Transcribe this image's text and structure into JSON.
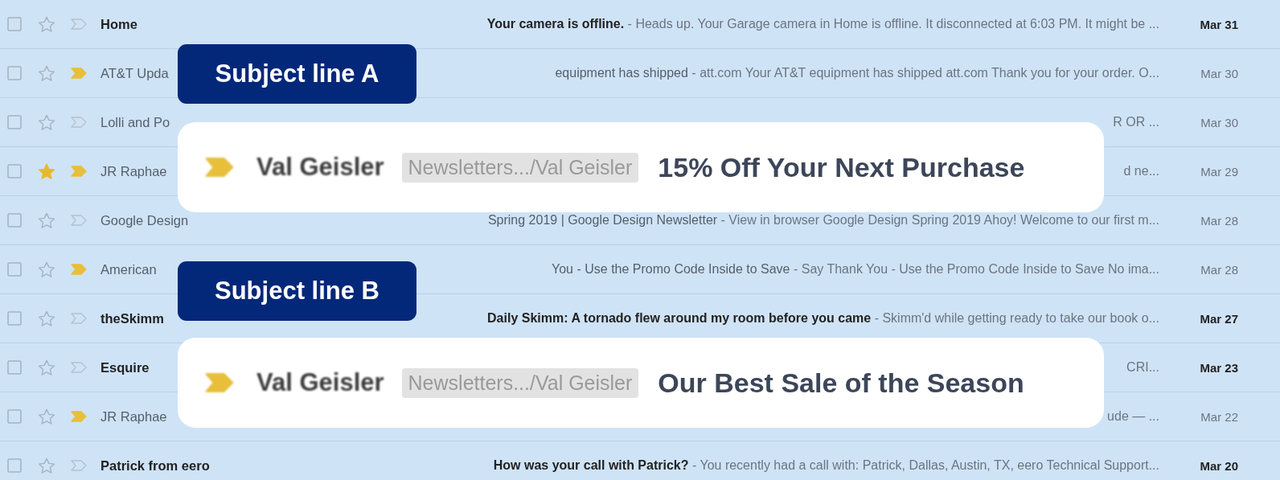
{
  "inbox": {
    "rows": [
      {
        "sender": "Home",
        "subject": "Your camera is offline.",
        "snippet": "- Heads up. Your Garage camera in Home is offline. It disconnected at 6:03 PM. It might be ...",
        "date": "Mar 31",
        "selected": false,
        "unread": true,
        "starred": false,
        "important": false
      },
      {
        "sender": "AT&T Upda",
        "subject": "equipment has shipped",
        "snippet": "- att.com Your AT&T equipment has shipped att.com Thank you for your order. O...",
        "date": "Mar 30",
        "selected": false,
        "unread": false,
        "starred": false,
        "important": true
      },
      {
        "sender": "Lolli and Po",
        "snippet": "R OR ...",
        "date": "Mar 30",
        "selected": false,
        "unread": false,
        "starred": false,
        "important": false
      },
      {
        "sender": "JR Raphae",
        "snippet": "d ne...",
        "date": "Mar 29",
        "selected": false,
        "unread": false,
        "starred": true,
        "important": true
      },
      {
        "sender": "Google Design",
        "subject": "Spring 2019 | Google Design Newsletter",
        "snippet": "- View in browser Google Design Spring 2019 Ahoy! Welcome to our first m...",
        "date": "Mar 28",
        "selected": false,
        "unread": false,
        "starred": false,
        "important": false
      },
      {
        "sender": "American",
        "subject": "You - Use the Promo Code Inside to Save",
        "snippet": "- Say Thank You - Use the Promo Code Inside to Save No ima...",
        "date": "Mar 28",
        "selected": false,
        "unread": false,
        "starred": false,
        "important": true
      },
      {
        "sender": "theSkimm",
        "subject": "Daily Skimm: A tornado flew around my room before you came",
        "snippet": "- Skimm'd while getting ready to take our book o...",
        "date": "Mar 27",
        "selected": false,
        "unread": true,
        "starred": false,
        "important": false
      },
      {
        "sender": "Esquire",
        "snippet": "CRI...",
        "date": "Mar 23",
        "selected": false,
        "unread": true,
        "starred": false,
        "important": false
      },
      {
        "sender": "JR Raphae",
        "snippet": "ude — ...",
        "date": "Mar 22",
        "selected": false,
        "unread": false,
        "starred": false,
        "important": true
      },
      {
        "sender": "Patrick from eero",
        "subject": "How was your call with Patrick?",
        "snippet": "- You recently had a call with: Patrick, Dallas, Austin, TX, eero Technical Support...",
        "date": "Mar 20",
        "selected": false,
        "unread": true,
        "starred": false,
        "important": false
      }
    ]
  },
  "callouts": [
    {
      "label": "Subject line A",
      "sender": "Val Geisler",
      "folder": "Newsletters.../Val Geisler",
      "subject": "15% Off Your Next Purchase"
    },
    {
      "label": "Subject line B",
      "sender": "Val Geisler",
      "folder": "Newsletters.../Val Geisler",
      "subject": "Our Best Sale of the Season"
    }
  ]
}
